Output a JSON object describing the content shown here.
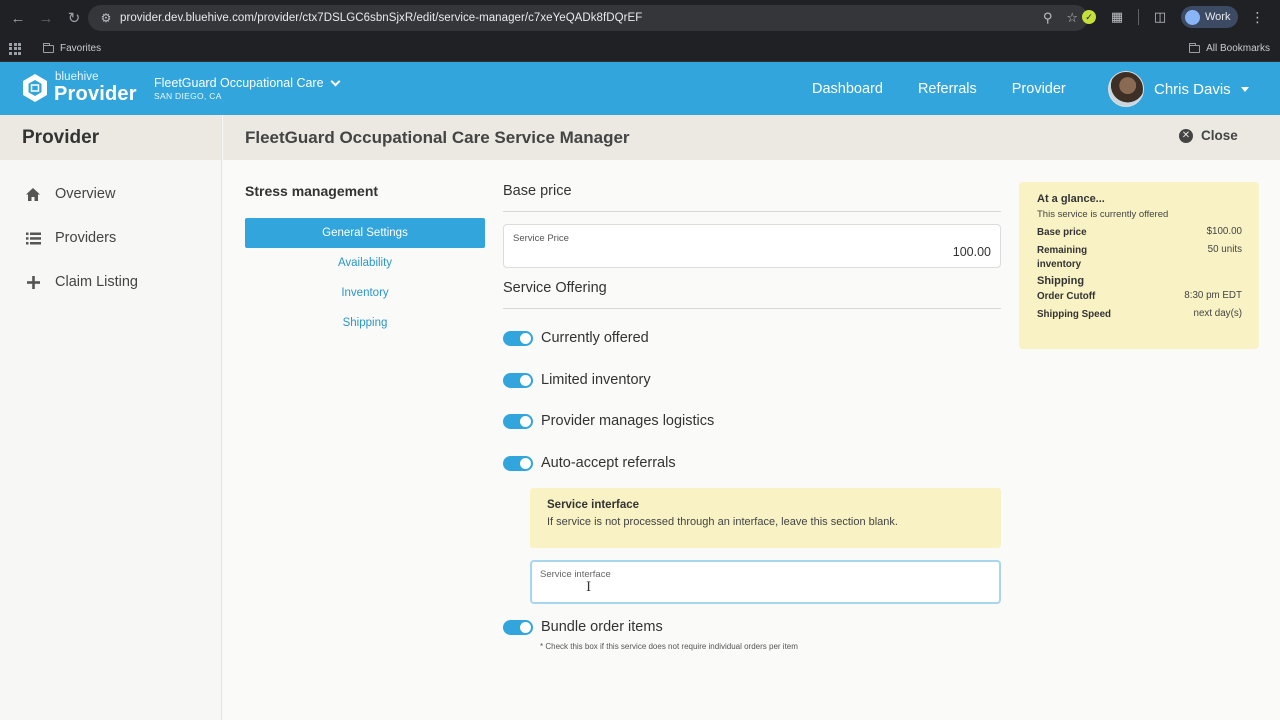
{
  "browser": {
    "url": "provider.dev.bluehive.com/provider/ctx7DSLGC6sbnSjxR/edit/service-manager/c7xeYeQADk8fDQrEF",
    "profile_label": "Work",
    "bookmarks_left": "Favorites",
    "bookmarks_right": "All Bookmarks"
  },
  "header": {
    "logo_small": "bluehive",
    "logo_big": "Provider",
    "org_name": "FleetGuard Occupational Care",
    "org_location": "SAN DIEGO, CA",
    "nav": [
      "Dashboard",
      "Referrals",
      "Provider"
    ],
    "user_name": "Chris Davis",
    "brand_color": "#31a5dc"
  },
  "sidebar": {
    "title": "Provider",
    "items": [
      {
        "label": "Overview",
        "icon": "home-icon"
      },
      {
        "label": "Providers",
        "icon": "list-icon"
      },
      {
        "label": "Claim Listing",
        "icon": "plus-icon"
      }
    ]
  },
  "page": {
    "title": "FleetGuard Occupational Care Service Manager",
    "close_label": "Close"
  },
  "service": {
    "name": "Stress management",
    "tabs": [
      "General Settings",
      "Availability",
      "Inventory",
      "Shipping"
    ],
    "active_tab": "General Settings"
  },
  "form": {
    "base_price_title": "Base price",
    "price_label": "Service Price",
    "price_value": "100.00",
    "offering_title": "Service Offering",
    "toggles": [
      {
        "label": "Currently offered",
        "on": true
      },
      {
        "label": "Limited inventory",
        "on": true
      },
      {
        "label": "Provider manages logistics",
        "on": true
      },
      {
        "label": "Auto-accept referrals",
        "on": true
      }
    ],
    "notice_title": "Service interface",
    "notice_text": "If service is not processed through an interface, leave this section blank.",
    "interface_label": "Service interface",
    "interface_value": "",
    "bundle_label": "Bundle order items",
    "bundle_on": true,
    "bundle_hint": "* Check this box if this service does not require individual orders per item"
  },
  "glance": {
    "title": "At a glance...",
    "status": "This service is currently offered",
    "base_price_label": "Base price",
    "base_price_value": "$100.00",
    "remaining_label": "Remaining inventory",
    "remaining_value": "50 units",
    "shipping_heading": "Shipping",
    "cutoff_label": "Order Cutoff",
    "cutoff_value": "8:30 pm EDT",
    "speed_label": "Shipping Speed",
    "speed_value": "next day(s)"
  }
}
